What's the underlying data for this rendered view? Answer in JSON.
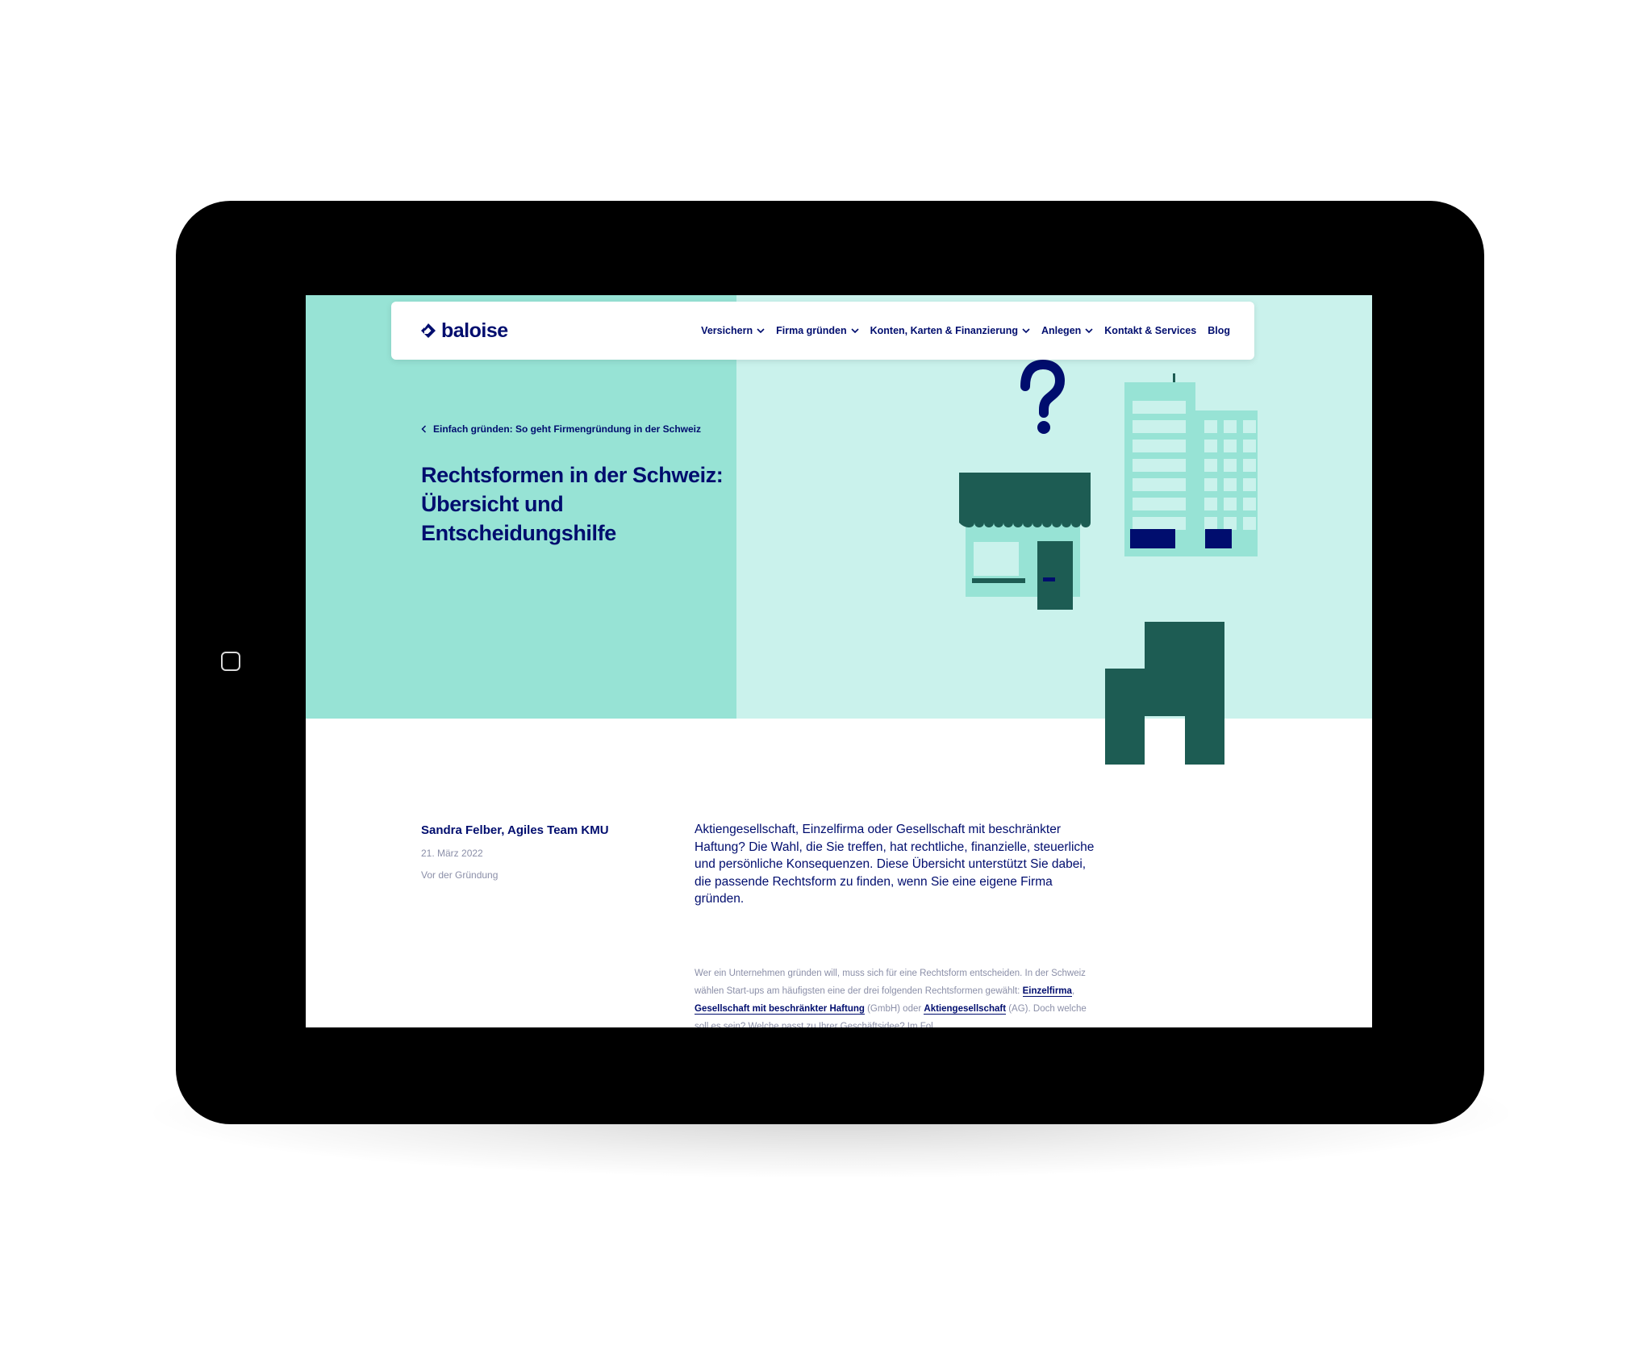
{
  "colors": {
    "brand_navy": "#000d6e",
    "hero_mint": "#97e3d5",
    "hero_light_mint": "#caf2ec",
    "dark_green": "#1d5c53",
    "muted_text": "#8b8fa8",
    "device": "#000000"
  },
  "device": {
    "type": "tablet",
    "home_button_icon": "home-button"
  },
  "nav": {
    "logo_text": "baloise",
    "logo_icon": "baloise-diamond-logo",
    "items": [
      {
        "label": "Versichern",
        "has_dropdown": true
      },
      {
        "label": "Firma gründen",
        "has_dropdown": true
      },
      {
        "label": "Konten, Karten & Finanzierung",
        "has_dropdown": true
      },
      {
        "label": "Anlegen",
        "has_dropdown": true
      },
      {
        "label": "Kontakt & Services",
        "has_dropdown": false
      },
      {
        "label": "Blog",
        "has_dropdown": false
      }
    ]
  },
  "hero": {
    "breadcrumb": "Einfach gründen: So geht Firmengründung in der Schweiz",
    "title": "Rechtsformen in der Schweiz: Übersicht und Entscheidungshilfe",
    "illustration_icons": [
      "question-mark-icon",
      "shop-icon",
      "office-building-icon",
      "house-icon"
    ]
  },
  "article": {
    "author": "Sandra Felber, Agiles Team KMU",
    "date": "21. März 2022",
    "category": "Vor der Gründung",
    "lead": "Aktiengesellschaft, Einzelfirma oder Gesellschaft mit beschränkter Haftung? Die Wahl, die Sie treffen, hat rechtliche, finanzielle, steu­erliche und persönliche Konsequenzen. Diese Übersicht unterstützt Sie dabei, die passende Rechtsform zu finden, wenn Sie eine eigene Firma gründen.",
    "body_intro": "Wer ein Unternehmen gründen will, muss sich für eine Rechtsform entscheiden. In der Schweiz wählen Start-ups am häufigsten eine der drei folgenden Rechtsformen ge­wählt: ",
    "link_einzelfirma": "Einzelfirma",
    "sep1": ", ",
    "link_gmbh": "Gesellschaft mit beschränkter Haftung",
    "gmbh_suffix": " (GmbH) oder ",
    "link_ag": "Aktienge­sellschaft",
    "body_outro": " (AG). Doch welche soll es sein? Welche passt zu Ihrer Geschäftsidee? Im Fol­"
  }
}
